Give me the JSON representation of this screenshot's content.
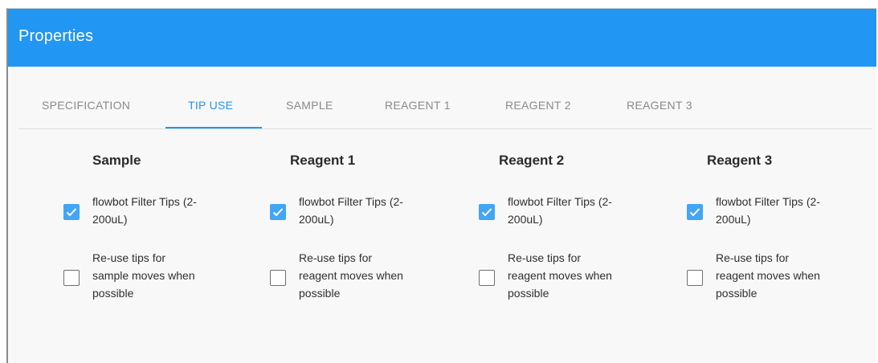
{
  "header": {
    "title": "Properties"
  },
  "tabs": [
    {
      "label": "SPECIFICATION",
      "active": false
    },
    {
      "label": "TIP USE",
      "active": true
    },
    {
      "label": "SAMPLE",
      "active": false
    },
    {
      "label": "REAGENT 1",
      "active": false
    },
    {
      "label": "REAGENT 2",
      "active": false
    },
    {
      "label": "REAGENT 3",
      "active": false
    }
  ],
  "columns": [
    {
      "title": "Sample",
      "tip_option": {
        "label_line1": "flowbot Filter Tips (2-",
        "label_line2": "200uL)",
        "checked": true
      },
      "reuse_option": {
        "label_line1": "Re-use tips for",
        "label_line2": "sample moves when",
        "label_line3": "possible",
        "checked": false
      }
    },
    {
      "title": "Reagent 1",
      "tip_option": {
        "label_line1": "flowbot Filter Tips (2-",
        "label_line2": "200uL)",
        "checked": true
      },
      "reuse_option": {
        "label_line1": "Re-use tips for",
        "label_line2": "reagent moves when",
        "label_line3": "possible",
        "checked": false
      }
    },
    {
      "title": "Reagent 2",
      "tip_option": {
        "label_line1": "flowbot Filter Tips (2-",
        "label_line2": "200uL)",
        "checked": true
      },
      "reuse_option": {
        "label_line1": "Re-use tips for",
        "label_line2": "reagent moves when",
        "label_line3": "possible",
        "checked": false
      }
    },
    {
      "title": "Reagent 3",
      "tip_option": {
        "label_line1": "flowbot Filter Tips (2-",
        "label_line2": "200uL)",
        "checked": true
      },
      "reuse_option": {
        "label_line1": "Re-use tips for",
        "label_line2": "reagent moves when",
        "label_line3": "possible",
        "checked": false
      }
    }
  ],
  "colors": {
    "accent": "#2196f3",
    "checkbox_checked": "#42a5f5"
  }
}
